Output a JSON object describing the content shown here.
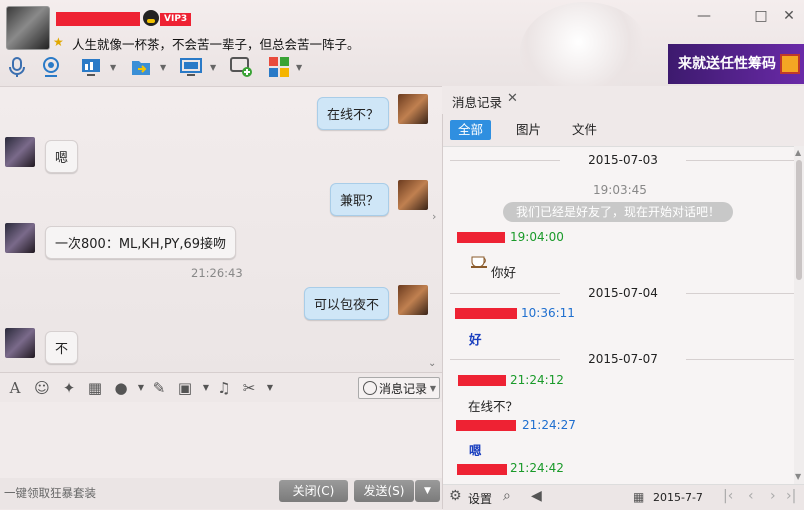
{
  "header": {
    "vip_badge": "VIP3",
    "signature": "人生就像一杯茶，不会苦一辈子，但总会苦一阵子。",
    "window": {
      "min": "—",
      "max": "□",
      "close": "✕"
    },
    "promo": "来就送任性筹码"
  },
  "chat": {
    "messages": [
      {
        "dir": "out",
        "text": "在线不？"
      },
      {
        "dir": "in",
        "text": "嗯"
      },
      {
        "dir": "out",
        "text": "兼职？"
      },
      {
        "dir": "in",
        "text": "一次800：ML,KH,PY,69接吻"
      },
      {
        "dir": "time",
        "text": "21:26:43"
      },
      {
        "dir": "out",
        "text": "可以包夜不"
      },
      {
        "dir": "in",
        "text": "不"
      }
    ]
  },
  "input": {
    "msg_record_label": "消息记录",
    "hint": "一键领取狂暴套装",
    "close_label": "关闭(C)",
    "send_label": "发送(S)"
  },
  "history": {
    "tab_title": "消息记录",
    "filters": [
      "全部",
      "图片",
      "文件"
    ],
    "entries": {
      "date1": "2015-07-03",
      "time_sys": "19:03:45",
      "sys_msg": "我们已经是好友了，现在开始对话吧！",
      "t1": "19:04:00",
      "m1": "你好",
      "date2": "2015-07-04",
      "t2": "10:36:11",
      "m2": "好",
      "date3": "2015-07-07",
      "t3": "21:24:12",
      "m3": "在线不？",
      "t4": "21:24:27",
      "m4": "嗯",
      "t5": "21:24:42"
    },
    "footer": {
      "settings_label": "设置",
      "date": "2015-7-7"
    }
  },
  "colors": {
    "accent": "#2f8fe0",
    "redact": "#ee2233",
    "bubble_out": "#cfe6f7"
  }
}
